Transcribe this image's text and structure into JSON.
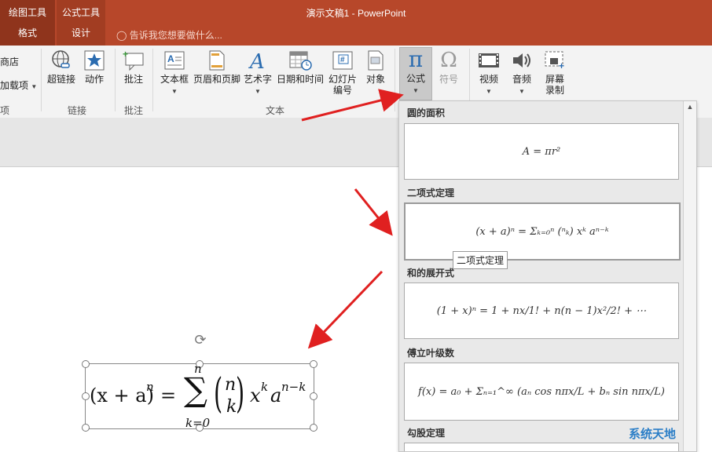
{
  "title_bar": {
    "app_title": "演示文稿1 - PowerPoint",
    "contextual_groups": [
      {
        "title": "绘图工具",
        "tab": "格式"
      },
      {
        "title": "公式工具",
        "tab": "设计"
      }
    ],
    "tell_me": "告诉我您想要做什么..."
  },
  "ribbon": {
    "left_cut": {
      "line1": "商店",
      "line2": "加载项",
      "group": "项"
    },
    "links": {
      "hyperlink": "超链接",
      "action": "动作",
      "group": "链接"
    },
    "comments": {
      "comment": "批注",
      "group": "批注"
    },
    "text": {
      "textbox": "文本框",
      "header_footer": "页眉和页脚",
      "wordart": "艺术字",
      "datetime": "日期和时间",
      "slide_number_1": "幻灯片",
      "slide_number_2": "编号",
      "object": "对象",
      "group": "文本"
    },
    "symbols": {
      "formula": "公式",
      "symbol": "符号"
    },
    "media": {
      "video": "视频",
      "audio": "音频",
      "screen_rec_1": "屏幕",
      "screen_rec_2": "录制"
    }
  },
  "gallery": {
    "sections": [
      {
        "header": "圆的面积",
        "formula": "A = πr²"
      },
      {
        "header": "二项式定理",
        "formula": "(x + a)ⁿ = Σₖ₌₀ⁿ (ⁿₖ) xᵏ aⁿ⁻ᵏ"
      },
      {
        "header": "和的展开式",
        "formula": "(1 + x)ⁿ = 1 + nx/1! + n(n − 1)x²/2! + ⋯"
      },
      {
        "header": "傅立叶级数",
        "formula": "f(x) = a₀ + Σₙ₌₁^∞ (aₙ cos nπx/L + bₙ sin nπx/L)"
      },
      {
        "header": "勾股定理",
        "formula": ""
      }
    ],
    "tooltip": "二项式定理"
  },
  "slide_equation": {
    "lhs": "(x + a)",
    "lhs_exp": "n",
    "equals": "=",
    "sum_symbol": "∑",
    "sum_upper": "n",
    "sum_lower": "k=0",
    "binom_top": "n",
    "binom_bottom": "k",
    "x": "x",
    "x_exp": "k",
    "a": "a",
    "a_exp": "n−k"
  },
  "watermark": "系统天地",
  "colors": {
    "accent": "#b7472a",
    "arrow": "#e02020"
  }
}
